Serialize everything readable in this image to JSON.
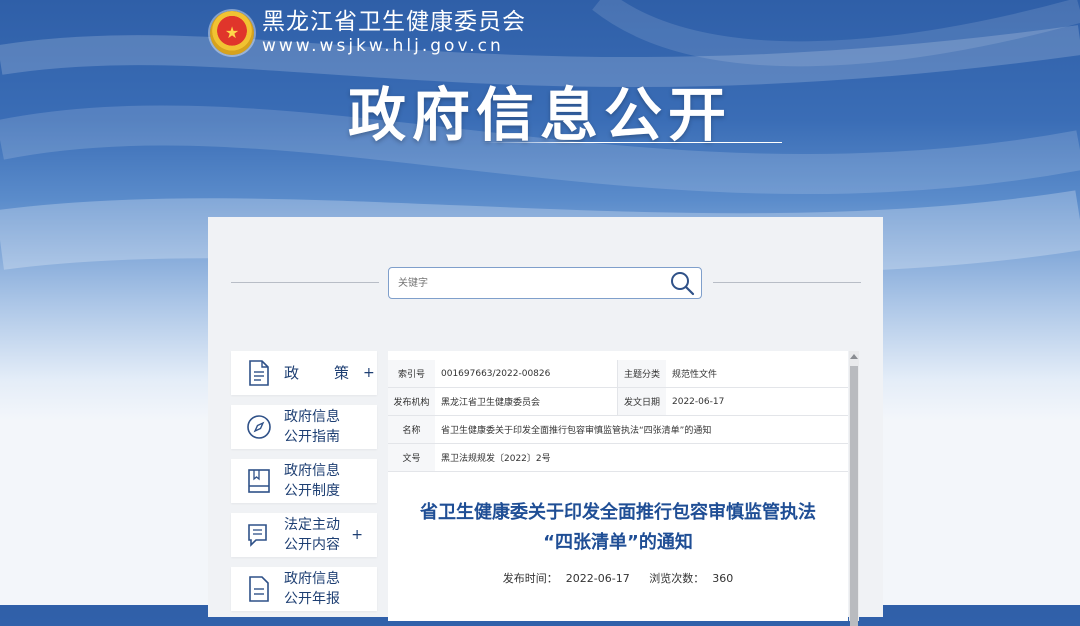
{
  "header": {
    "site_name": "黑龙江省卫生健康委员会",
    "site_url": "www.wsjkw.hlj.gov.cn",
    "emblem_icon": "national-emblem-icon"
  },
  "hero": {
    "title": "政府信息公开"
  },
  "search": {
    "placeholder": "关键字",
    "icon": "search-icon"
  },
  "sidebar": {
    "items": [
      {
        "label": "政　策",
        "expand": "+",
        "icon": "document-icon"
      },
      {
        "label_line1": "政府信息",
        "label_line2": "公开指南",
        "icon": "compass-icon"
      },
      {
        "label_line1": "政府信息",
        "label_line2": "公开制度",
        "icon": "book-icon"
      },
      {
        "label_line1": "法定主动",
        "label_line2": "公开内容",
        "expand": "+",
        "icon": "chat-list-icon"
      },
      {
        "label_line1": "政府信息",
        "label_line2": "公开年报",
        "icon": "report-icon"
      }
    ]
  },
  "document": {
    "meta": {
      "index_label": "索引号",
      "index_value": "001697663/2022-00826",
      "category_label": "主题分类",
      "category_value": "规范性文件",
      "publisher_label": "发布机构",
      "publisher_value": "黑龙江省卫生健康委员会",
      "date_label": "发文日期",
      "date_value": "2022-06-17",
      "name_label": "名称",
      "name_value": "省卫生健康委关于印发全面推行包容审慎监管执法“四张清单”的通知",
      "docno_label": "文号",
      "docno_value": "黑卫法规规发〔2022〕2号"
    },
    "title_line1": "省卫生健康委关于印发全面推行包容审慎监管执法",
    "title_line2": "“四张清单”的通知",
    "publish_label": "发布时间：",
    "publish_date": "2022-06-17",
    "views_label": "浏览次数：",
    "views": "360"
  },
  "colors": {
    "accent": "#1f4e95",
    "nav_text": "#1e3f73",
    "banner": "#3a6db6"
  }
}
